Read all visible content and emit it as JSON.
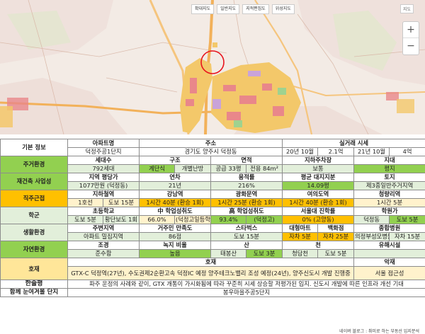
{
  "map": {
    "controls": [
      "확대지도",
      "일반지도",
      "지적편집도",
      "위성지도"
    ],
    "map_tag": "지도",
    "zoom_in": "+",
    "zoom_out": "−",
    "colors": {
      "residential": "#f3c86a",
      "commercial": "#e9878a",
      "road": "#f2b15a",
      "green": "#dde9c8"
    }
  },
  "table": {
    "basic": {
      "label": "기본 정보",
      "name_hd": "아파트명",
      "name": "덕정주공1단지",
      "addr_hd": "주소",
      "addr": "경기도 양주시 덕정동",
      "trade_hd": "실거래 시세",
      "trade": [
        "20년 10월",
        "2.1억",
        "21년 10월",
        "4억"
      ]
    },
    "living": {
      "label": "주거환경",
      "households_hd": "세대수",
      "households": "792세대",
      "structure_hd": "구조",
      "structure_a": "계단식",
      "structure_b": "개별난방",
      "area_hd": "면적",
      "area_a": "공급 33평",
      "area_b": "전용 84m²",
      "parking_hd": "지하주차장",
      "parking": "보통",
      "terrain_hd": "지대",
      "terrain": "평지"
    },
    "rebuild": {
      "label": "재건축 사업성",
      "price_hd": "지역 평당가",
      "price": "1077만원 (덕정동)",
      "age_hd": "연차",
      "age": "21년",
      "far_hd": "용적률",
      "far": "216%",
      "land_hd": "평균 대지지분",
      "land": "14.09평",
      "zone_hd": "토지",
      "zone": "제3종일반주거지역"
    },
    "commute": {
      "label": "직주근접",
      "metro_hd": "지하철역",
      "metro_a": "1호선",
      "metro_b": "도보 15분",
      "gangnam_hd": "강남역",
      "gangnam": "1시간 40분 (환승 1회)",
      "gwanghwamun_hd": "광화문역",
      "gwanghwamun": "1시간 25분 (환승 1회)",
      "yeouido_hd": "여의도역",
      "yeouido": "1시간 40분 (환승 1회)",
      "cheongnyangni_hd": "청량리역",
      "cheongnyangni": "1시간 5분"
    },
    "school": {
      "label": "학군",
      "elem_hd": "초등학교",
      "elem_a": "도보 5분",
      "elem_b": "황단보도 1회",
      "middle_hd": "中 학업성취도",
      "middle_a": "66.0%",
      "middle_b": "(덕정고일등학원)",
      "high_hd": "高 학업성취도",
      "high_a": "93.4%",
      "high_b": "(덕정고)",
      "univ_hd": "서울대 진학률",
      "univ": "0% (고양동)",
      "academy_hd": "학원가",
      "academy_a": "덕정동",
      "academy_b": "도보 5분"
    },
    "life": {
      "label": "생활환경",
      "area_hd": "주변지역",
      "area": "아파트 밀집지역",
      "satisfaction_hd": "거주민 만족도",
      "satisfaction": "86점",
      "starbucks_hd": "스타벅스",
      "starbucks": "도보 15분",
      "mart_hd": "대형마트",
      "mart": "자차 5분",
      "dept_hd": "백화점",
      "dept": "자차 25분",
      "hospital_hd": "종합병원",
      "hospital_a": "의정부성모병원",
      "hospital_b": "자차 15분"
    },
    "nature": {
      "label": "자연환경",
      "view_hd": "조경",
      "view": "준수함",
      "green_hd": "녹지 비율",
      "green": "높음",
      "mountain_hd": "산",
      "mountain_a": "태봉산",
      "mountain_b": "도보 3분",
      "stream_hd": "천",
      "stream_a": "청담천",
      "stream_b": "도보 5분",
      "bad_hd": "유해시설",
      "bad": ""
    },
    "issues": {
      "label": "호재",
      "good_hd": "호재",
      "good": "GTX-C 덕정역(27년), 수도권제2순환고속 덕정IC 예정   양주테크노밸리 조성 예정(24년), 양주신도시 개발 진행중",
      "bad_hd": "악재",
      "bad": "서울 접근성"
    },
    "review": {
      "label": "한줄평",
      "text": "파주 운정의 사례와 같이, GTX 개통이 가시화됨에 따라 꾸준히 시세 상승할 저평가된 입지. 신도시 개발에 따른 인프라 개선 기대"
    },
    "compare": {
      "label": "함께 눈여겨볼 단지",
      "text": "봉우마을주공5단지"
    }
  },
  "footer": "네이버 블로그 : 취미로 하는 부동산 입지분석"
}
